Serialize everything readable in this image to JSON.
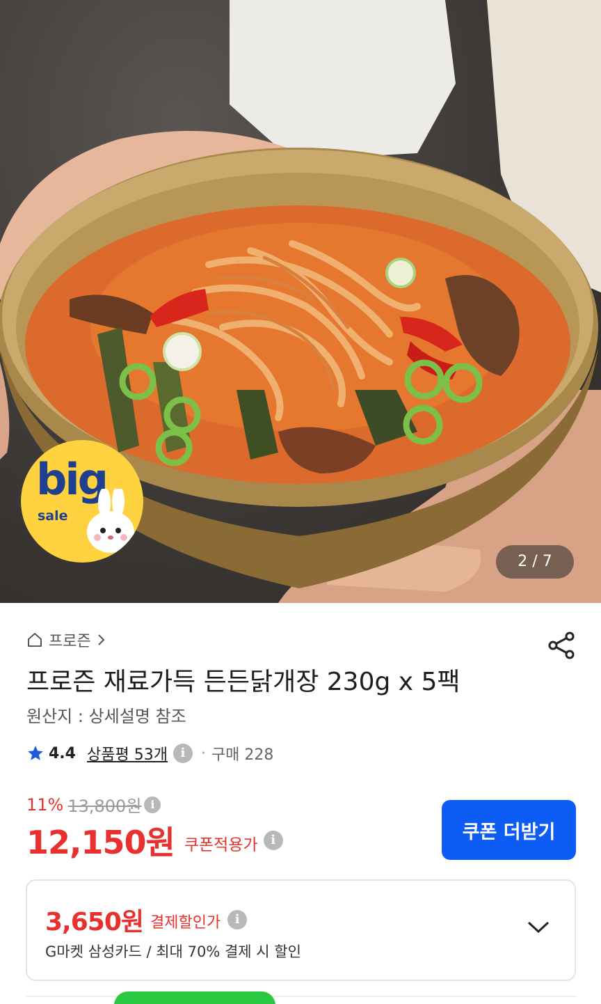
{
  "gallery": {
    "counter": "2 / 7",
    "badge": {
      "big": "big",
      "sale": "sale"
    }
  },
  "breadcrumb": {
    "category": "프로즌"
  },
  "product": {
    "title": "프로즌 재료가득 든든닭개장 230g x 5팩",
    "origin": "원산지 : 상세설명 참조",
    "rating": "4.4",
    "reviews": "상품평 53개",
    "purchases": "구매 228"
  },
  "pricing": {
    "discount_pct": "11%",
    "original_price": "13,800원",
    "price": "12,150원",
    "price_label": "쿠폰적용가",
    "coupon_button": "쿠폰 더받기"
  },
  "card_discount": {
    "amount": "3,650원",
    "amount_label": "결제할인가",
    "description": "G마켓 삼성카드 / 최대 70% 결제 시 할인"
  },
  "colors": {
    "accent_red": "#e8312f",
    "button_blue": "#0d5cf5",
    "badge_yellow": "#ffd23f",
    "badge_navy": "#1f3f8f"
  },
  "icons": [
    "home-icon",
    "chevron-right-icon",
    "share-icon",
    "star-icon",
    "info-icon",
    "chevron-down-icon",
    "bunny-icon"
  ]
}
